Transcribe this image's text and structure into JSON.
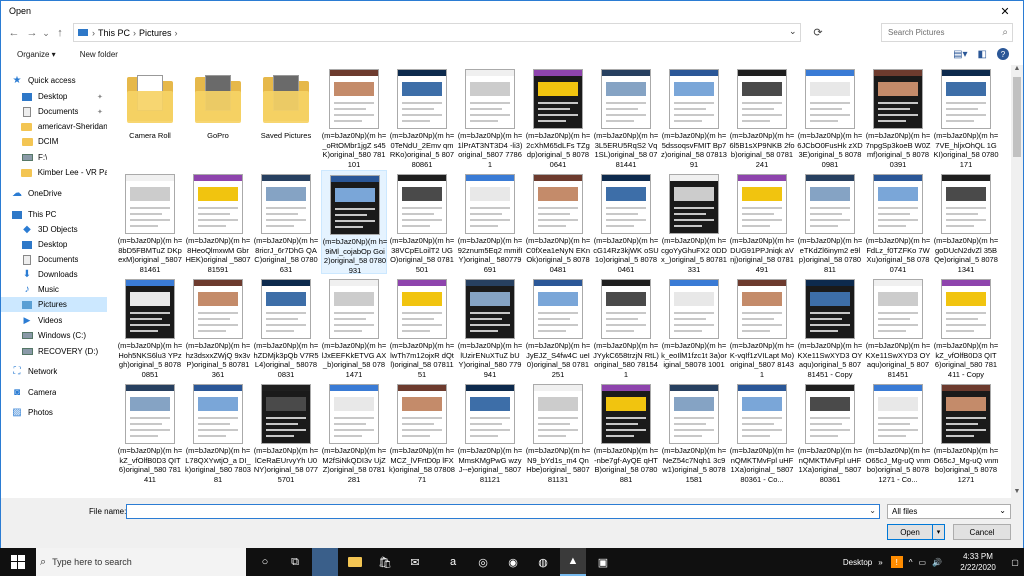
{
  "window": {
    "title": "Open",
    "close": "✕"
  },
  "address": {
    "back": "←",
    "forward": "→",
    "up_history": "⌄",
    "up": "↑",
    "crumbs": [
      "This PC",
      "Pictures"
    ],
    "search_placeholder": "Search Pictures"
  },
  "toolbar": {
    "organize": "Organize ▾",
    "new_folder": "New folder",
    "view_icon": "view-icon",
    "pane_icon": "preview-pane-icon",
    "help_icon": "help-icon"
  },
  "sidebar": {
    "items": [
      {
        "label": "Quick access",
        "icon": "star-icon"
      },
      {
        "label": "Desktop",
        "icon": "desktop-icon",
        "pinned": true
      },
      {
        "label": "Documents",
        "icon": "documents-icon",
        "pinned": true
      },
      {
        "label": "americavr-Sheridan",
        "icon": "folder-icon"
      },
      {
        "label": "DCIM",
        "icon": "folder-icon"
      },
      {
        "label": "F:\\",
        "icon": "drive-icon"
      },
      {
        "label": "Kimber Lee - VR Pa",
        "icon": "folder-icon"
      },
      {
        "label": "OneDrive",
        "icon": "cloud-icon"
      },
      {
        "label": "This PC",
        "icon": "computer-icon"
      },
      {
        "label": "3D Objects",
        "icon": "objects-icon"
      },
      {
        "label": "Desktop",
        "icon": "desktop-icon"
      },
      {
        "label": "Documents",
        "icon": "documents-icon"
      },
      {
        "label": "Downloads",
        "icon": "downloads-icon"
      },
      {
        "label": "Music",
        "icon": "music-icon"
      },
      {
        "label": "Pictures",
        "icon": "pictures-icon",
        "selected": true
      },
      {
        "label": "Videos",
        "icon": "videos-icon"
      },
      {
        "label": "Windows (C:)",
        "icon": "drive-icon"
      },
      {
        "label": "RECOVERY (D:)",
        "icon": "drive-icon"
      },
      {
        "label": "Network",
        "icon": "network-icon"
      },
      {
        "label": "Camera",
        "icon": "camera-icon"
      },
      {
        "label": "Photos",
        "icon": "photos-icon"
      }
    ]
  },
  "files": [
    {
      "name": "Camera Roll",
      "kind": "folder"
    },
    {
      "name": "GoPro",
      "kind": "folder"
    },
    {
      "name": "Saved Pictures",
      "kind": "folder"
    },
    {
      "name": "(m=bJaz0Np)(m h=_oRtOMbr1jgZ s45K)original_580 781101",
      "kind": "image"
    },
    {
      "name": "(m=bJaz0Np)(m h=0TeNdU_2Emv qmRKo)original_5 80780861",
      "kind": "image"
    },
    {
      "name": "(m=bJaz0Np)(m h=1lPrAT3NT3D4 -li3)original_5807 77861",
      "kind": "image"
    },
    {
      "name": "(m=bJaz0Np)(m h=2cXhM65dLFs TZgdp)original_5 80780641",
      "kind": "image"
    },
    {
      "name": "(m=bJaz0Np)(m h=3L5ERU5RqS2 Vq1SL)original_58 0781441",
      "kind": "image"
    },
    {
      "name": "(m=bJaz0Np)(m h=5dssoqsvFMIT Bp7z)original_58 0781391",
      "kind": "image"
    },
    {
      "name": "(m=bJaz0Np)(m h=6l5B1sXP9NKB 2fob)original_58 0781241",
      "kind": "image"
    },
    {
      "name": "(m=bJaz0Np)(m h=6JCbO0FusHk zXD3E)original_5 80780981",
      "kind": "image"
    },
    {
      "name": "(m=bJaz0Np)(m h=7npgSp3koeB W0Zmf)original_5 80780391",
      "kind": "image"
    },
    {
      "name": "(m=bJaz0Np)(m h=7VE_hljxOhQL 1GKI)original_58 0780171",
      "kind": "image"
    },
    {
      "name": "(m=bJaz0Np)(m h=8bD5FBMTuZ DKpexM)original _580781461",
      "kind": "image"
    },
    {
      "name": "(m=bJaz0Np)(m h=8HeoQlmxwM GbrHEK)original _580781591",
      "kind": "image"
    },
    {
      "name": "(m=bJaz0Np)(m h=8ricrJ_6r7DhG QAC)original_58 0780631",
      "kind": "image"
    },
    {
      "name": "(m=bJaz0Np)(m h=9iMl_cojabOp Goi2)original_58 0780931",
      "kind": "image",
      "highlight": true
    },
    {
      "name": "(m=bJaz0Np)(m h=38VCpELoilT2 UGO)original_58 0781501",
      "kind": "image"
    },
    {
      "name": "(m=bJaz0Np)(m h=92znum5Eq2 mmifIY)original_ 580779691",
      "kind": "image"
    },
    {
      "name": "(m=bJaz0Np)(m h=C0fXea1eNyN EKnOk)original_5 80780481",
      "kind": "image"
    },
    {
      "name": "(m=bJaz0Np)(m h=cG14Rz3kjWK oSU1o)original_5 80780461",
      "kind": "image"
    },
    {
      "name": "(m=bJaz0Np)(m h=cgoYyGhuFX2 0DDx_)original_5 80781331",
      "kind": "image"
    },
    {
      "name": "(m=bJaz0Np)(m h=DUG91PPJniqk aVnj)original_58 0781491",
      "kind": "image"
    },
    {
      "name": "(m=bJaz0Np)(m h=eTKdZl6inym2 e9lp)original_58 0780811",
      "kind": "image"
    },
    {
      "name": "(m=bJaz0Np)(m h=FdLz_f0TZFKo 7WXu)original_58 0780741",
      "kind": "image"
    },
    {
      "name": "(m=bJaz0Np)(m h=goDUcN2dvZl 35BQe)original_5 80781341",
      "kind": "image"
    },
    {
      "name": "(m=bJaz0Np)(m h=Hoh5NKS6lu3 YPzgh)original_5 80780851",
      "kind": "image"
    },
    {
      "name": "(m=bJaz0Np)(m h=hz3dsxxZWjQ 9x3vP)original_5 80781361",
      "kind": "image"
    },
    {
      "name": "(m=bJaz0Np)(m h=hZDMjk3pQb V7R5L4)original_ 580780831",
      "kind": "image"
    },
    {
      "name": "(m=bJaz0Np)(m h=lJxEEFKkETVG AX_b)original_58 0781471",
      "kind": "image"
    },
    {
      "name": "(m=bJaz0Np)(m h=lwTh7m12ojxR dQtl)original_58 0781151",
      "kind": "image"
    },
    {
      "name": "(m=bJaz0Np)(m h=lUzirENuXTuZ bUY)original_580 779941",
      "kind": "image"
    },
    {
      "name": "(m=bJaz0Np)(m h=JyEJZ_S4fw4C ueI0)original_58 0781251",
      "kind": "image"
    },
    {
      "name": "(m=bJaz0Np)(m h=JYykC658trzjN RtL)original_580 781541",
      "kind": "image"
    },
    {
      "name": "(m=bJaz0Np)(m h=k_eoIlM1fzc1t 3a)original_58078 1001",
      "kind": "image"
    },
    {
      "name": "(m=bJaz0Np)(m h=K-vqIf1zVILapt Mo)original_5807 81431",
      "kind": "image"
    },
    {
      "name": "(m=bJaz0Np)(m h=KXe11SwXYD3 OYaqu)original_5 80781451 - Copy",
      "kind": "image"
    },
    {
      "name": "(m=bJaz0Np)(m h=KXe11SwXYD3 OYaqu)original_5 80781451",
      "kind": "image"
    },
    {
      "name": "(m=bJaz0Np)(m h=kZ_vfOlfB0D3 QIT6)original_580 781411 - Copy",
      "kind": "image"
    },
    {
      "name": "(m=bJaz0Np)(m h=kZ_vfOlfB0D3 QIT6)original_580 781411",
      "kind": "image"
    },
    {
      "name": "(m=bJaz0Np)(m h=L78QXYwtjO_a DI_k)original_580 780381",
      "kind": "image"
    },
    {
      "name": "(m=bJaz0Np)(m h=lCeRaEUrvyYh U0NY)original_58 0775701",
      "kind": "image"
    },
    {
      "name": "(m=bJaz0Np)(m h=M2fSiNkQDI3v UjZZ)original_58 0781281",
      "kind": "image"
    },
    {
      "name": "(m=bJaz0Np)(m h=MCZ_lVFrtD0p lFXk)original_58 0780871",
      "kind": "image"
    },
    {
      "name": "(m=bJaz0Np)(m h=MmsKMgPwG wzyJ--e)original_ 580781121",
      "kind": "image"
    },
    {
      "name": "(m=bJaz0Np)(m h=N9_bYd1s_m4 QnHbe)original_ 580781131",
      "kind": "image"
    },
    {
      "name": "(m=bJaz0Np)(m h=-nbe7gf-AyQE qHTB)original_58 0780881",
      "kind": "image"
    },
    {
      "name": "(m=bJaz0Np)(m h=NeZ54c7Nqh1 3c9w1)original_5 80781581",
      "kind": "image"
    },
    {
      "name": "(m=bJaz0Np)(m h=nQMKTMvFpl uHF1Xa)original_ 580780361 - Co...",
      "kind": "image"
    },
    {
      "name": "(m=bJaz0Np)(m h=nQMKTMvFpl uHF1Xa)original_ 580780361",
      "kind": "image"
    },
    {
      "name": "(m=bJaz0Np)(m h=O65cJ_Mg-uQ vnmbo)original_5 80781271 - Co...",
      "kind": "image"
    },
    {
      "name": "(m=bJaz0Np)(m h=O65cJ_Mg-uQ vnmbo)original_5 80781271",
      "kind": "image"
    }
  ],
  "footer": {
    "file_name_label": "File name:",
    "file_name_value": "",
    "file_type": "All files",
    "open": "Open",
    "cancel": "Cancel"
  },
  "taskbar": {
    "search_placeholder": "Type here to search",
    "desktop_label": "Desktop",
    "time": "4:33 PM",
    "date": "2/22/2020",
    "notification_count": "1"
  },
  "colors": {
    "accent": "#2b7cd3",
    "selection": "#cce8ff",
    "taskbar": "#101010"
  }
}
